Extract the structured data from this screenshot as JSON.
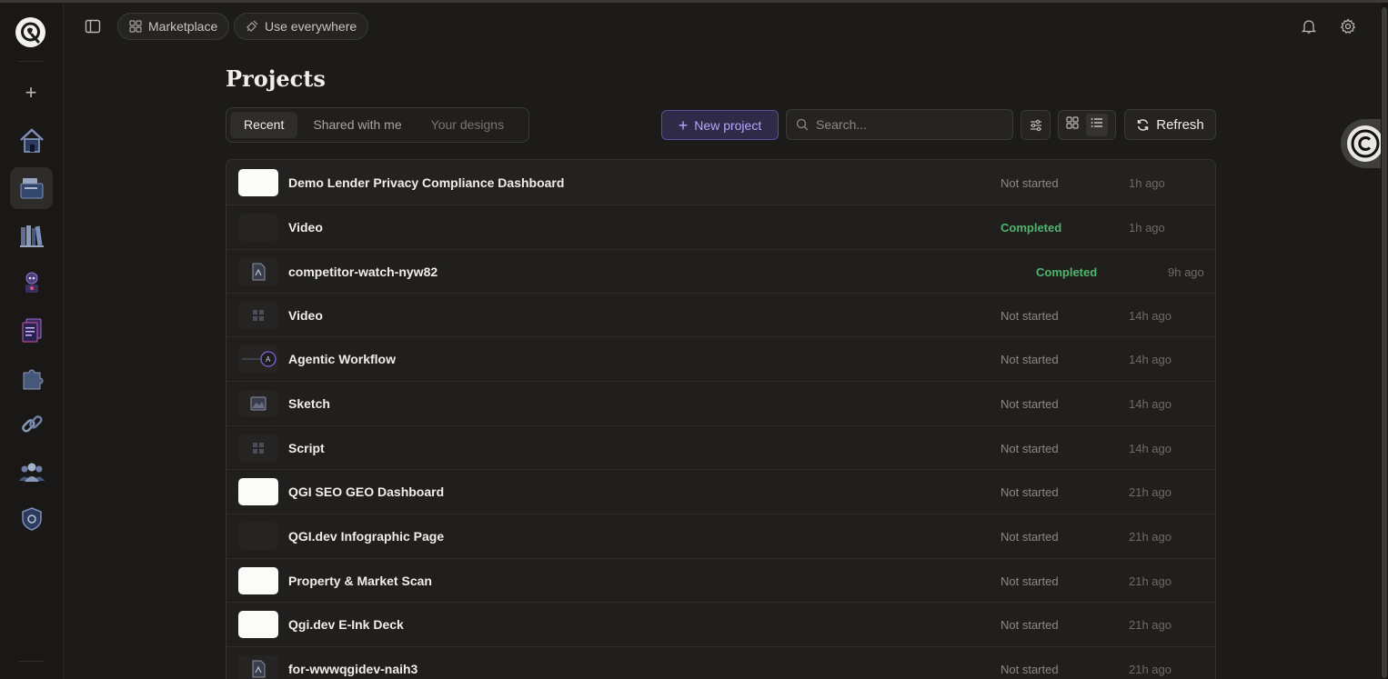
{
  "header": {
    "marketplace_label": "Marketplace",
    "use_everywhere_label": "Use everywhere"
  },
  "sidebar": {
    "logo_letter": "Q",
    "items": [
      {
        "icon": "home-icon"
      },
      {
        "icon": "projects-folder-icon",
        "active": true
      },
      {
        "icon": "library-books-icon"
      },
      {
        "icon": "agent-robot-icon"
      },
      {
        "icon": "documents-icon"
      },
      {
        "icon": "puzzle-plugin-icon"
      },
      {
        "icon": "link-chain-icon"
      },
      {
        "icon": "team-users-icon"
      },
      {
        "icon": "security-shield-icon"
      }
    ]
  },
  "main": {
    "title": "Projects",
    "tabs": [
      {
        "label": "Recent",
        "active": true
      },
      {
        "label": "Shared with me"
      },
      {
        "label": "Your designs"
      }
    ],
    "new_project_label": "New project",
    "search_placeholder": "Search...",
    "refresh_label": "Refresh",
    "projects": [
      {
        "title": "Demo Lender Privacy Compliance Dashboard",
        "status": "Not started",
        "time": "1h ago",
        "thumb": "white"
      },
      {
        "title": "Video",
        "status": "Completed",
        "time": "1h ago",
        "thumb": "dark"
      },
      {
        "title": "competitor-watch-nyw82",
        "status": "Completed",
        "time": "9h ago",
        "thumb": "doc"
      },
      {
        "title": "Video",
        "status": "Not started",
        "time": "14h ago",
        "thumb": "grid"
      },
      {
        "title": "Agentic Workflow",
        "status": "Not started",
        "time": "14h ago",
        "thumb": "workflow"
      },
      {
        "title": "Sketch",
        "status": "Not started",
        "time": "14h ago",
        "thumb": "image"
      },
      {
        "title": "Script",
        "status": "Not started",
        "time": "14h ago",
        "thumb": "grid"
      },
      {
        "title": "QGI SEO GEO Dashboard",
        "status": "Not started",
        "time": "21h ago",
        "thumb": "white"
      },
      {
        "title": "QGI.dev Infographic Page",
        "status": "Not started",
        "time": "21h ago",
        "thumb": "dark"
      },
      {
        "title": "Property & Market Scan",
        "status": "Not started",
        "time": "21h ago",
        "thumb": "white"
      },
      {
        "title": "Qgi.dev E-Ink Deck",
        "status": "Not started",
        "time": "21h ago",
        "thumb": "white"
      },
      {
        "title": "for-wwwqgidev-naih3",
        "status": "Not started",
        "time": "21h ago",
        "thumb": "doc"
      }
    ]
  },
  "colors": {
    "background": "#1c1b1a",
    "accent": "#b9a6ff",
    "completed": "#4fb56d",
    "muted": "#8d8982"
  }
}
